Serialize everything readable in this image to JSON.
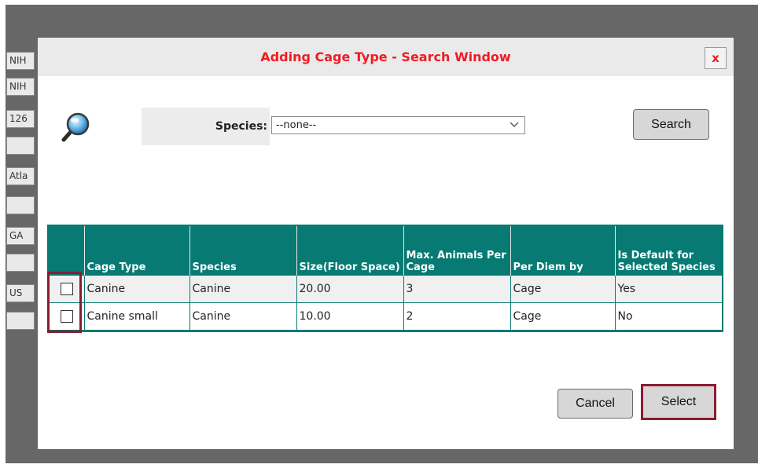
{
  "background": {
    "fields": [
      "NIH",
      "NIH",
      "126",
      "",
      "Atla",
      "",
      "GA",
      "",
      "US",
      ""
    ]
  },
  "dialog": {
    "title": "Adding Cage Type - Search Window",
    "close_label": "x",
    "search_icon": "magnifier-icon",
    "species_label": "Species:",
    "species_value": "--none--",
    "search_button": "Search",
    "cancel_button": "Cancel",
    "select_button": "Select",
    "colors": {
      "title": "#ee1c24",
      "table_header": "#067a73",
      "highlight": "#8b1c32"
    }
  },
  "table": {
    "headers": [
      "Cage Type",
      "Species",
      "Size(Floor Space)",
      "Max. Animals Per Cage",
      "Per Diem by",
      "Is Default for Selected Species"
    ],
    "rows": [
      {
        "checked": false,
        "cage_type": "Canine",
        "species": "Canine",
        "size": "20.00",
        "max_animals": "3",
        "per_diem": "Cage",
        "is_default": "Yes"
      },
      {
        "checked": false,
        "cage_type": "Canine small",
        "species": "Canine",
        "size": "10.00",
        "max_animals": "2",
        "per_diem": "Cage",
        "is_default": "No"
      }
    ]
  }
}
